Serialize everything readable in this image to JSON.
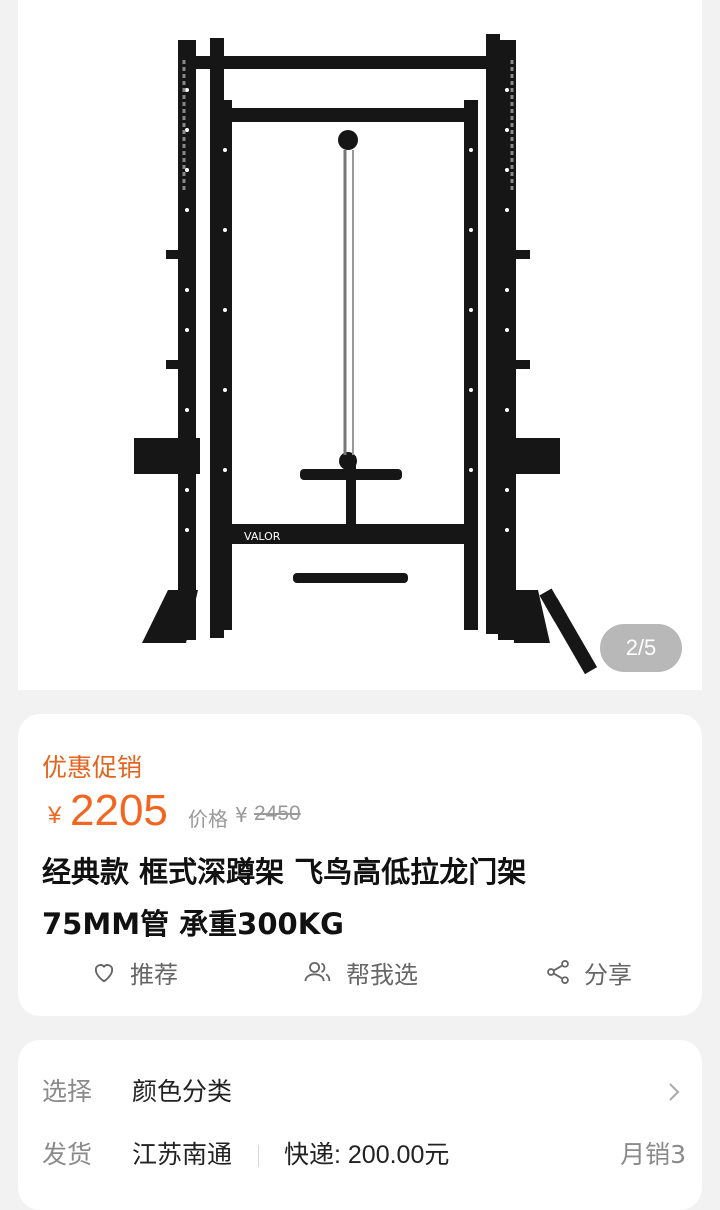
{
  "gallery": {
    "page_indicator": "2/5",
    "rack_brand": "VALOR"
  },
  "promo": {
    "label": "优惠促销"
  },
  "price": {
    "currency": "¥",
    "current": "2205",
    "original_label": "价格",
    "original_currency": "¥",
    "original": "2450"
  },
  "product": {
    "title_line1": "经典款  框式深蹲架  飞鸟高低拉龙门架",
    "title_line2": "75MM管 承重300KG"
  },
  "actions": {
    "recommend": "推荐",
    "help_choose": "帮我选",
    "share": "分享"
  },
  "spec": {
    "select_label": "选择",
    "select_value": "颜色分类",
    "ship_label": "发货",
    "ship_from": "江苏南通",
    "express": "快递: 200.00元",
    "monthly_sales": "月销3"
  },
  "colors": {
    "accent": "#f2661f",
    "promo": "#e4631d"
  },
  "icons": [
    "heart-icon",
    "people-icon",
    "share-icon",
    "chevron-right-icon"
  ]
}
